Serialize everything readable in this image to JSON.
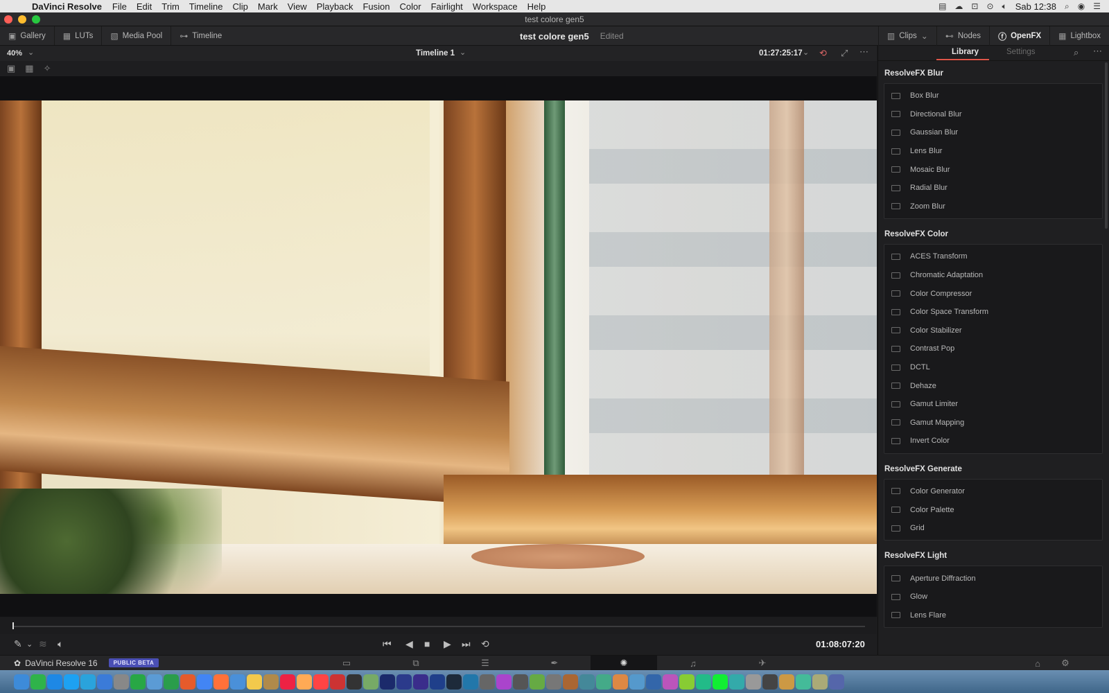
{
  "menubar": {
    "app_name": "DaVinci Resolve",
    "items": [
      "File",
      "Edit",
      "Trim",
      "Timeline",
      "Clip",
      "Mark",
      "View",
      "Playback",
      "Fusion",
      "Color",
      "Fairlight",
      "Workspace",
      "Help"
    ],
    "clock": "Sab 12:38"
  },
  "window": {
    "title": "test colore gen5"
  },
  "toolbar": {
    "gallery": "Gallery",
    "luts": "LUTs",
    "media_pool": "Media Pool",
    "timeline": "Timeline",
    "project_name": "test colore gen5",
    "project_status": "Edited",
    "clips": "Clips",
    "nodes": "Nodes",
    "openfx": "OpenFX",
    "lightbox": "Lightbox"
  },
  "viewer": {
    "zoom": "40%",
    "timeline_name": "Timeline 1",
    "timecode_top": "01:27:25:17",
    "timecode_bottom": "01:08:07:20",
    "playhead_fraction": 0.0
  },
  "panel": {
    "tab_library": "Library",
    "tab_settings": "Settings",
    "sections": [
      {
        "title": "ResolveFX Blur",
        "items": [
          "Box Blur",
          "Directional Blur",
          "Gaussian Blur",
          "Lens Blur",
          "Mosaic Blur",
          "Radial Blur",
          "Zoom Blur"
        ]
      },
      {
        "title": "ResolveFX Color",
        "items": [
          "ACES Transform",
          "Chromatic Adaptation",
          "Color Compressor",
          "Color Space Transform",
          "Color Stabilizer",
          "Contrast Pop",
          "DCTL",
          "Dehaze",
          "Gamut Limiter",
          "Gamut Mapping",
          "Invert Color"
        ]
      },
      {
        "title": "ResolveFX Generate",
        "items": [
          "Color Generator",
          "Color Palette",
          "Grid"
        ]
      },
      {
        "title": "ResolveFX Light",
        "items": [
          "Aperture Diffraction",
          "Glow",
          "Lens Flare"
        ]
      }
    ]
  },
  "pagebar": {
    "brand": "DaVinci Resolve 16",
    "beta_badge": "PUBLIC BETA",
    "pages": [
      "media-page-icon",
      "cut-page-icon",
      "edit-page-icon",
      "fusion-page-icon",
      "color-page-icon",
      "fairlight-page-icon",
      "deliver-page-icon"
    ],
    "active_page": 4
  },
  "colors": {
    "accent_tab": "#e0564a",
    "beta_badge": "#4a4fb5"
  }
}
